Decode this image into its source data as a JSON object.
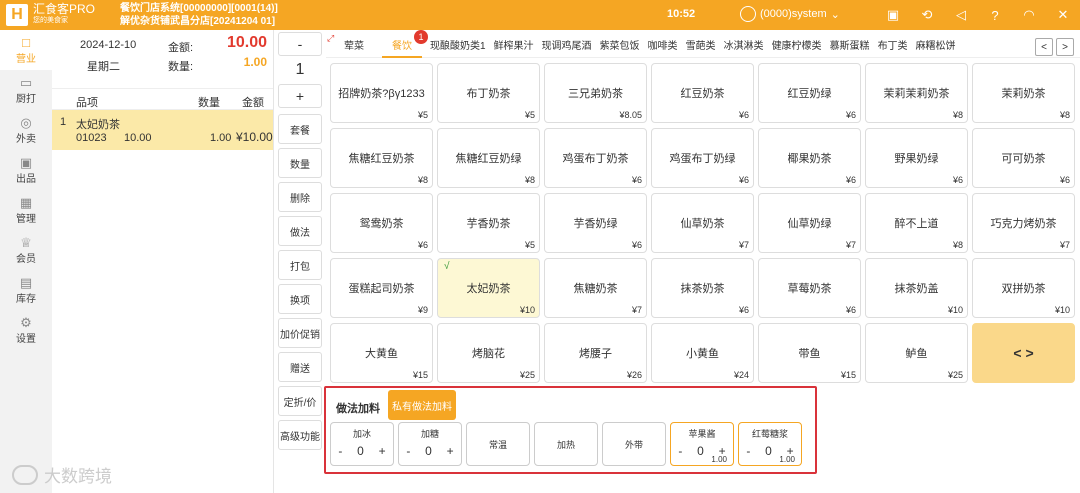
{
  "header": {
    "logo_letter": "H",
    "brand": "汇食客PRO",
    "brand_sub": "您的美食家",
    "store_line1": "餐饮门店系统[00000000][0001(14)]",
    "store_line2": "解优杂货铺武昌分店[20241204 01]",
    "time": "10:52",
    "user": "(0000)system",
    "icons": [
      "camera-icon",
      "sync-icon",
      "volume-icon",
      "help-icon",
      "wifi-icon",
      "close-icon"
    ]
  },
  "sidebar": {
    "items": [
      {
        "label": "营业",
        "icon": "□"
      },
      {
        "label": "厨打",
        "icon": "▭"
      },
      {
        "label": "外卖",
        "icon": "◎"
      },
      {
        "label": "出品",
        "icon": "▣"
      },
      {
        "label": "管理",
        "icon": "▦"
      },
      {
        "label": "会员",
        "icon": "♕"
      },
      {
        "label": "库存",
        "icon": "▤"
      },
      {
        "label": "设置",
        "icon": "⚙"
      }
    ]
  },
  "summary": {
    "date": "2024-12-10",
    "weekday": "星期二",
    "amount_label": "金额:",
    "amount": "10.00",
    "qty_label": "数量:",
    "qty": "1.00"
  },
  "order": {
    "headers": [
      "品项",
      "数量",
      "金额"
    ],
    "rows": [
      {
        "index": "1",
        "name": "太妃奶茶",
        "code": "01023",
        "price": "10.00",
        "qty": "1.00",
        "amount": "¥10.00"
      }
    ]
  },
  "controls": {
    "minus": "-",
    "qty": "1",
    "plus": "+",
    "buttons": [
      "套餐",
      "数量",
      "删除",
      "做法",
      "打包",
      "换项",
      "加价促销",
      "赠送",
      "定折/价",
      "高级功能"
    ]
  },
  "tabs": [
    {
      "label": "荤菜"
    },
    {
      "label": "餐饮",
      "badge": "1"
    },
    {
      "label": "现酿酸奶类1"
    },
    {
      "label": "鲜榨果汁"
    },
    {
      "label": "现调鸡尾酒"
    },
    {
      "label": "紫菜包饭"
    },
    {
      "label": "咖啡类"
    },
    {
      "label": "雪葩类"
    },
    {
      "label": "冰淇淋类"
    },
    {
      "label": "健康柠檬类"
    },
    {
      "label": "慕斯蛋糕"
    },
    {
      "label": "布丁类"
    },
    {
      "label": "麻糬松饼"
    }
  ],
  "tab_nav": {
    "prev": "<",
    "next": ">"
  },
  "products": [
    {
      "name": "招牌奶茶?βγ1233",
      "price": "¥5"
    },
    {
      "name": "布丁奶茶",
      "price": "¥5"
    },
    {
      "name": "三兄弟奶茶",
      "price": "¥8.05"
    },
    {
      "name": "红豆奶茶",
      "price": "¥6"
    },
    {
      "name": "红豆奶绿",
      "price": "¥6"
    },
    {
      "name": "茉莉茉莉奶茶",
      "price": "¥8"
    },
    {
      "name": "茉莉奶茶",
      "price": "¥8"
    },
    {
      "name": "焦糖红豆奶茶",
      "price": "¥8"
    },
    {
      "name": "焦糖红豆奶绿",
      "price": "¥8"
    },
    {
      "name": "鸡蛋布丁奶茶",
      "price": "¥6"
    },
    {
      "name": "鸡蛋布丁奶绿",
      "price": "¥6"
    },
    {
      "name": "椰果奶茶",
      "price": "¥6"
    },
    {
      "name": "野果奶绿",
      "price": "¥6"
    },
    {
      "name": "可可奶茶",
      "price": "¥6"
    },
    {
      "name": "鸳鸯奶茶",
      "price": "¥6"
    },
    {
      "name": "芋香奶茶",
      "price": "¥5"
    },
    {
      "name": "芋香奶绿",
      "price": "¥6"
    },
    {
      "name": "仙草奶茶",
      "price": "¥7"
    },
    {
      "name": "仙草奶绿",
      "price": "¥7"
    },
    {
      "name": "醉不上道",
      "price": "¥8"
    },
    {
      "name": "巧克力烤奶茶",
      "price": "¥7"
    },
    {
      "name": "蛋糕起司奶茶",
      "price": "¥9"
    },
    {
      "name": "太妃奶茶",
      "price": "¥10",
      "selected": true
    },
    {
      "name": "焦糖奶茶",
      "price": "¥7"
    },
    {
      "name": "抹茶奶茶",
      "price": "¥6"
    },
    {
      "name": "草莓奶茶",
      "price": "¥6"
    },
    {
      "name": "抹茶奶盖",
      "price": "¥10"
    },
    {
      "name": "双拼奶茶",
      "price": "¥10"
    },
    {
      "name": "大黄鱼",
      "price": "¥15"
    },
    {
      "name": "烤脑花",
      "price": "¥25"
    },
    {
      "name": "烤腰子",
      "price": "¥26"
    },
    {
      "name": "小黄鱼",
      "price": "¥24"
    },
    {
      "name": "带鱼",
      "price": "¥15"
    },
    {
      "name": "鲈鱼",
      "price": "¥25"
    }
  ],
  "page_nav": "<  >",
  "check_mark": "√",
  "addons": {
    "title": "做法加料",
    "tab": "私有做法加料",
    "options": [
      {
        "name": "加冰",
        "type": "stepper",
        "value": "0",
        "minus": "-",
        "plus": "+"
      },
      {
        "name": "加糖",
        "type": "stepper",
        "value": "0",
        "minus": "-",
        "plus": "+"
      },
      {
        "name": "常温",
        "type": "plain"
      },
      {
        "name": "加热",
        "type": "plain"
      },
      {
        "name": "外带",
        "type": "plain"
      },
      {
        "name": "苹果酱",
        "type": "stepper",
        "value": "0",
        "minus": "-",
        "plus": "+",
        "price": "1.00"
      },
      {
        "name": "红莓糖浆",
        "type": "stepper",
        "value": "0",
        "minus": "-",
        "plus": "+",
        "price": "1.00"
      }
    ]
  },
  "watermark": "大数跨境",
  "colors": {
    "accent": "#f5a623",
    "danger": "#e23a2e",
    "selected_row": "#fbe9a8"
  }
}
